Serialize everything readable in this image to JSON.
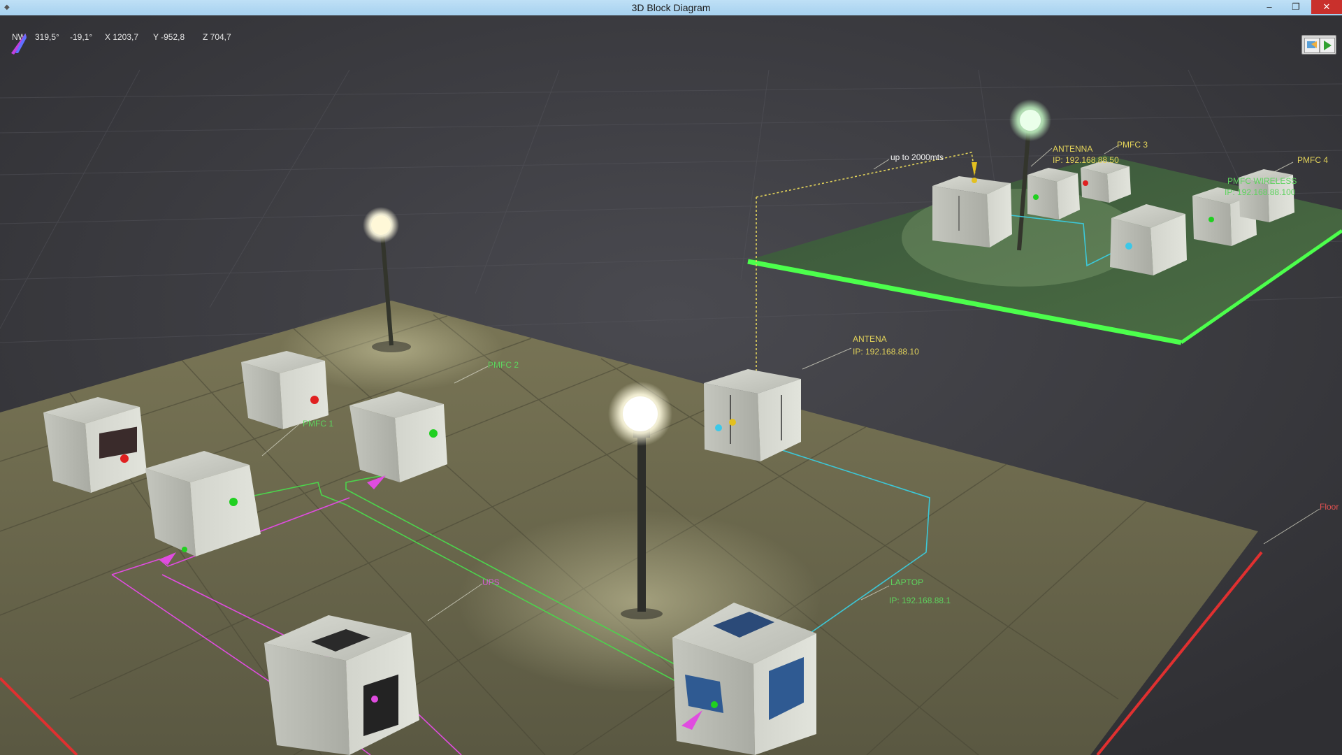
{
  "window": {
    "title": "3D Block Diagram",
    "minimize": "–",
    "restore": "❐",
    "close": "✕"
  },
  "status": {
    "orientation": "NW",
    "angle1": "319,5°",
    "angle2": "-19,1°",
    "x": "X 1203,7",
    "y": "Y -952,8",
    "z": "Z 704,7"
  },
  "labels": {
    "pmfc2": "PMFC 2",
    "pmfc1": "PMFC 1",
    "antena_main": "ANTENA",
    "antena_main_ip": "IP: 192.168.88.10",
    "laptop": "LAPTOP",
    "laptop_ip": "IP: 192.168.88.1",
    "ups": "UPS",
    "floor": "Floor",
    "distance": "up to 2000mts",
    "antenna_remote": "ANTENNA",
    "antenna_remote_ip": "IP: 192.168.88.50",
    "pmfc3": "PMFC 3",
    "pmfc4": "PMFC 4",
    "pmfc_wireless": "PMFC WIRELESS",
    "pmfc_wireless_ip": "IP: 192.168.88.100"
  },
  "colors": {
    "background": "#2b2b2e",
    "floor_tile": "#6b6a4a",
    "green_platform": "#3f5a3a",
    "accent_green": "#4cff4c",
    "link_green": "#4cd44c",
    "link_cyan": "#3cc8d8",
    "link_magenta": "#e04ce0",
    "axis_red": "#e03030"
  }
}
